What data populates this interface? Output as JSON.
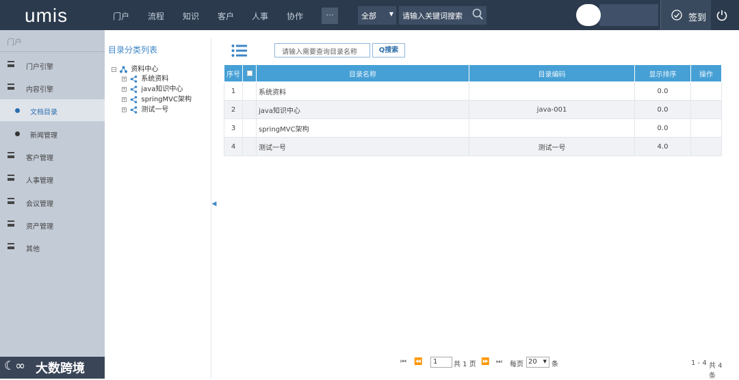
{
  "header": {
    "logo": "umis",
    "nav": [
      "门户",
      "流程",
      "知识",
      "客户",
      "人事",
      "协作"
    ],
    "more_label": "···",
    "scope": "全部",
    "search_placeholder": "请输入关键词搜索",
    "signin_label": "签到"
  },
  "sidebar": {
    "title": "门户",
    "items": [
      {
        "label": "门户引擎"
      },
      {
        "label": "内容引擎"
      },
      {
        "label": "文档目录"
      },
      {
        "label": "新闻管理"
      },
      {
        "label": "客户管理"
      },
      {
        "label": "人事管理"
      },
      {
        "label": "会议管理"
      },
      {
        "label": "资产管理"
      },
      {
        "label": "其他"
      }
    ]
  },
  "watermark": {
    "logo": "☾∞",
    "text": "大数跨境"
  },
  "tree": {
    "title": "目录分类列表",
    "root": "资料中心",
    "children": [
      "系统资料",
      "java知识中心",
      "springMVC架构",
      "测试一号"
    ]
  },
  "toolbar": {
    "search_placeholder": "请输入需要查询目录名称",
    "search_button": "Q搜索"
  },
  "table": {
    "headers": [
      "序号",
      "",
      "目录名称",
      "目录编码",
      "显示排序",
      "操作"
    ],
    "rows": [
      {
        "no": "1",
        "name": "系统资料",
        "code": "",
        "order": "0.0"
      },
      {
        "no": "2",
        "name": "java知识中心",
        "code": "java-001",
        "order": "0.0"
      },
      {
        "no": "3",
        "name": "springMVC架构",
        "code": "",
        "order": "0.0"
      },
      {
        "no": "4",
        "name": "测试一号",
        "code": "测试一号",
        "order": "4.0"
      }
    ]
  },
  "pager": {
    "current_page": "1",
    "total_pages_text": "共 1 页",
    "per_page_label": "每页",
    "per_page": "20",
    "unit": "条",
    "range": "1 - 4",
    "total": "共 4 条"
  },
  "colors": {
    "topbar": "#2b3a4d",
    "sidebar": "#c3cbd6",
    "table_header": "#46a0d5",
    "accent": "#3d86c8"
  }
}
